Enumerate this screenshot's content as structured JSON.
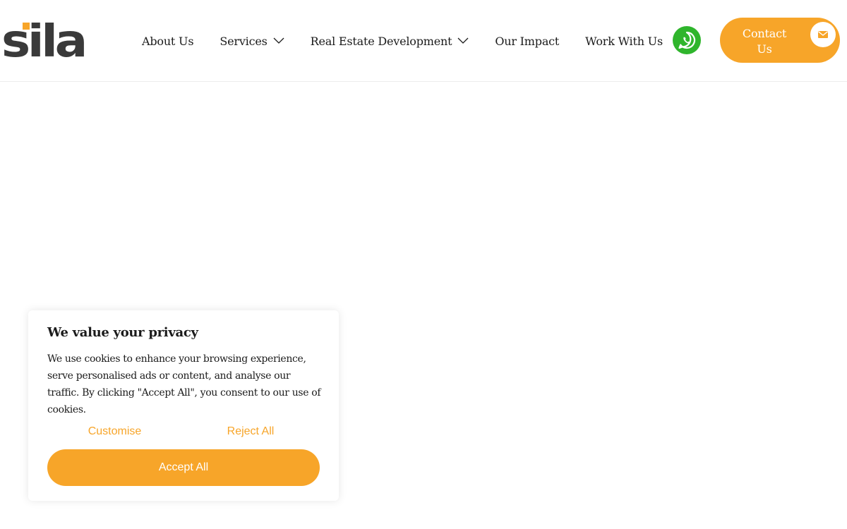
{
  "brand": {
    "logo_text": "sila",
    "accent_color": "#f7a529",
    "whatsapp_color": "#2fb52c"
  },
  "nav": {
    "items": [
      {
        "label": "About Us",
        "has_dropdown": false
      },
      {
        "label": "Services",
        "has_dropdown": true
      },
      {
        "label": "Real Estate Development",
        "has_dropdown": true
      },
      {
        "label": "Our Impact",
        "has_dropdown": false
      },
      {
        "label": "Work With Us",
        "has_dropdown": false
      }
    ],
    "whatsapp_icon": "whatsapp-icon",
    "contact_label": "Contact Us",
    "contact_icon": "envelope-icon"
  },
  "cookie": {
    "title": "We value your privacy",
    "text": "We use cookies to enhance your browsing experience, serve personalised ads or content, and analyse our traffic. By clicking \"Accept All\", you consent to our use of cookies.",
    "customise_label": "Customise",
    "reject_label": "Reject All",
    "accept_label": "Accept All"
  }
}
